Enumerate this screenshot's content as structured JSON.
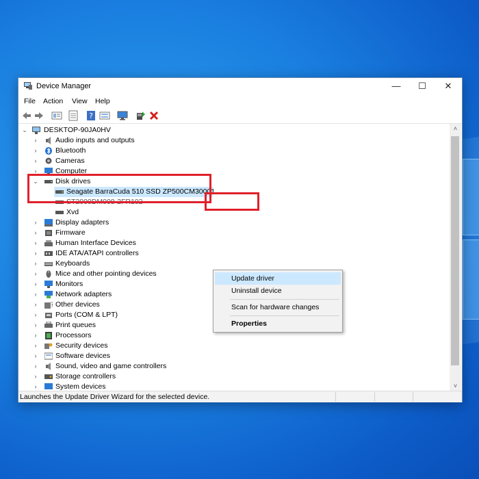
{
  "window": {
    "title": "Device Manager",
    "minimize": "—",
    "maximize": "☐",
    "close": "✕"
  },
  "menu": [
    "File",
    "Action",
    "View",
    "Help"
  ],
  "toolbar": [
    "back-arrow-icon",
    "forward-arrow-icon",
    "properties-icon",
    "refresh-icon",
    "help-icon",
    "view-icon",
    "monitor-icon",
    "install-driver-icon",
    "uninstall-icon"
  ],
  "tree": {
    "root": "DESKTOP-90JA0HV",
    "nodes": [
      "Audio inputs and outputs",
      "Bluetooth",
      "Cameras",
      "Computer",
      "Disk drives",
      "Seagate BarraCuda 510 SSD ZP500CM30001",
      "ST2000DM008-2FR102",
      "Xvd",
      "Display adapters",
      "Firmware",
      "Human Interface Devices",
      "IDE ATA/ATAPI controllers",
      "Keyboards",
      "Mice and other pointing devices",
      "Monitors",
      "Network adapters",
      "Other devices",
      "Ports (COM & LPT)",
      "Print queues",
      "Processors",
      "Security devices",
      "Software devices",
      "Sound, video and game controllers",
      "Storage controllers",
      "System devices"
    ]
  },
  "context_menu": {
    "update": "Update driver",
    "uninstall": "Uninstall device",
    "scan": "Scan for hardware changes",
    "properties": "Properties"
  },
  "status": "Launches the Update Driver Wizard for the selected device.",
  "colors": {
    "highlight": "#cce8ff",
    "annotation": "#e0202a",
    "desktop": "#1a7fe0"
  }
}
